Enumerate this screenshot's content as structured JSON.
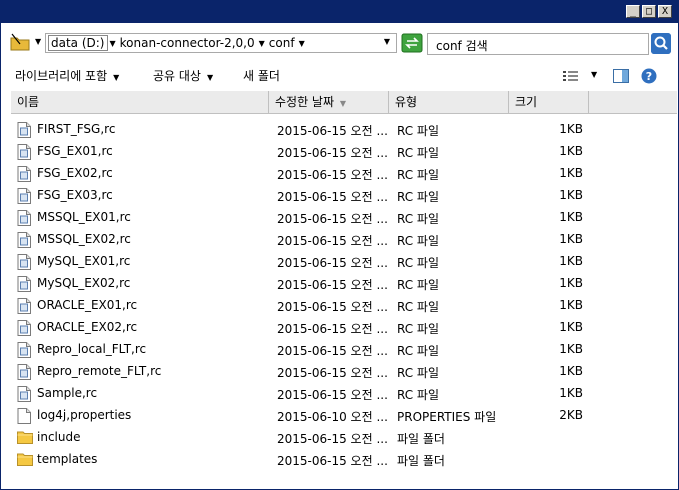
{
  "window": {
    "buttons": {
      "minimize": "_",
      "maximize": "□",
      "close": "X"
    }
  },
  "address": {
    "crumbs": [
      "data (D:)",
      "konan-connector-2,0,0",
      "conf"
    ],
    "search_placeholder": "conf 검색"
  },
  "toolbar": {
    "include_library": "라이브러리에 포함",
    "share_with": "공유 대상",
    "new_folder": "새 폴더"
  },
  "columns": {
    "name": "이름",
    "date": "수정한 날짜",
    "type": "유형",
    "size": "크기"
  },
  "files": [
    {
      "name": "FIRST_FSG,rc",
      "date": "2015-06-15 오전 ...",
      "type": "RC 파일",
      "size": "1KB",
      "kind": "file"
    },
    {
      "name": "FSG_EX01,rc",
      "date": "2015-06-15 오전 ...",
      "type": "RC 파일",
      "size": "1KB",
      "kind": "file"
    },
    {
      "name": "FSG_EX02,rc",
      "date": "2015-06-15 오전 ...",
      "type": "RC 파일",
      "size": "1KB",
      "kind": "file"
    },
    {
      "name": "FSG_EX03,rc",
      "date": "2015-06-15 오전 ...",
      "type": "RC 파일",
      "size": "1KB",
      "kind": "file"
    },
    {
      "name": "MSSQL_EX01,rc",
      "date": "2015-06-15 오전 ...",
      "type": "RC 파일",
      "size": "1KB",
      "kind": "file"
    },
    {
      "name": "MSSQL_EX02,rc",
      "date": "2015-06-15 오전 ...",
      "type": "RC 파일",
      "size": "1KB",
      "kind": "file"
    },
    {
      "name": "MySQL_EX01,rc",
      "date": "2015-06-15 오전 ...",
      "type": "RC 파일",
      "size": "1KB",
      "kind": "file"
    },
    {
      "name": "MySQL_EX02,rc",
      "date": "2015-06-15 오전 ...",
      "type": "RC 파일",
      "size": "1KB",
      "kind": "file"
    },
    {
      "name": "ORACLE_EX01,rc",
      "date": "2015-06-15 오전 ...",
      "type": "RC 파일",
      "size": "1KB",
      "kind": "file"
    },
    {
      "name": "ORACLE_EX02,rc",
      "date": "2015-06-15 오전 ...",
      "type": "RC 파일",
      "size": "1KB",
      "kind": "file"
    },
    {
      "name": "Repro_local_FLT,rc",
      "date": "2015-06-15 오전 ...",
      "type": "RC 파일",
      "size": "1KB",
      "kind": "file"
    },
    {
      "name": "Repro_remote_FLT,rc",
      "date": "2015-06-15 오전 ...",
      "type": "RC 파일",
      "size": "1KB",
      "kind": "file"
    },
    {
      "name": "Sample,rc",
      "date": "2015-06-15 오전 ...",
      "type": "RC 파일",
      "size": "1KB",
      "kind": "file"
    },
    {
      "name": "log4j,properties",
      "date": "2015-06-10 오전 ...",
      "type": "PROPERTIES 파일",
      "size": "2KB",
      "kind": "blank"
    },
    {
      "name": "include",
      "date": "2015-06-15 오전 ...",
      "type": "파일 폴더",
      "size": "",
      "kind": "folder"
    },
    {
      "name": "templates",
      "date": "2015-06-15 오전 ...",
      "type": "파일 폴더",
      "size": "",
      "kind": "folder"
    }
  ],
  "colors": {
    "titlebar": "#0a246a",
    "folder": "#f5c842",
    "search_button": "#2f6fbf"
  }
}
